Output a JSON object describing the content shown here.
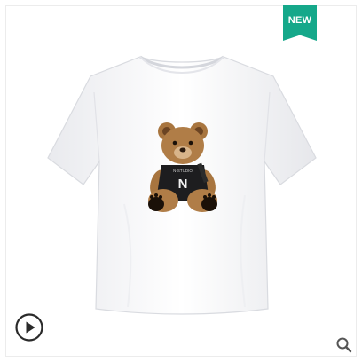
{
  "badge": {
    "label": "NEW",
    "color": "#15a88a"
  },
  "product": {
    "bear_shirt_letter": "N",
    "bear_shirt_script": "N-STUDIO"
  },
  "controls": {
    "play_icon": "play-circle-icon",
    "search_icon": "magnifier-icon"
  }
}
